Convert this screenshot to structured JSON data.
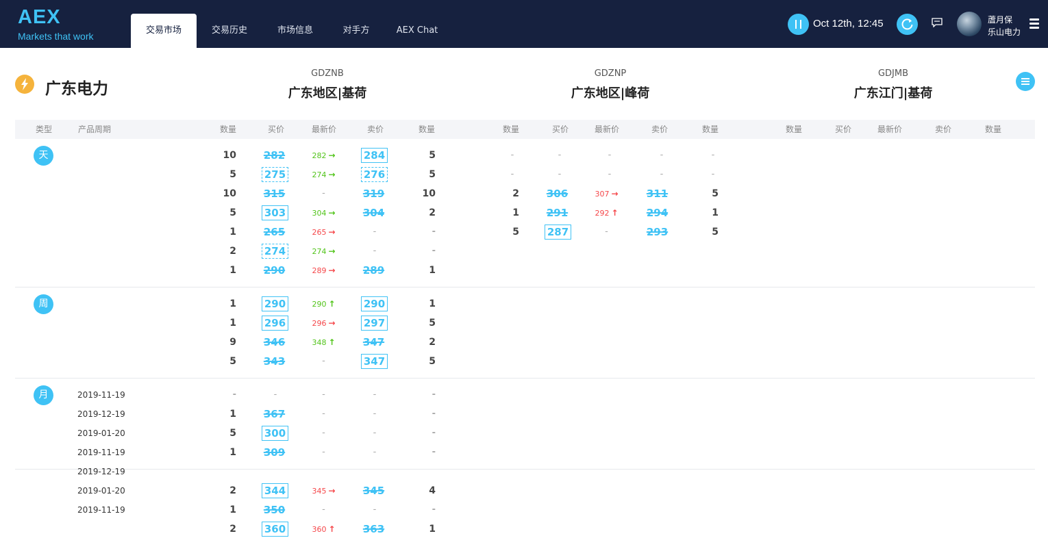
{
  "app": {
    "logo_title": "AEX",
    "logo_tagline": "Markets that work"
  },
  "nav": {
    "tabs": [
      {
        "label": "交易市场",
        "active": true
      },
      {
        "label": "交易历史"
      },
      {
        "label": "市场信息"
      },
      {
        "label": "对手方"
      },
      {
        "label": "AEX Chat"
      }
    ]
  },
  "header_right": {
    "pause_icon": "pause-icon",
    "clock": "Oct 12th, 12:45",
    "refresh_icon": "refresh-icon",
    "chat_icon": "chat-icon",
    "user_name": "蔖月保",
    "user_company": "乐山电力",
    "menu_icon": "hamburger-icon"
  },
  "market": {
    "title": "广东电力",
    "icon": "lightning-icon"
  },
  "instruments": [
    {
      "code": "GDZNB",
      "name": "广东地区|基荷"
    },
    {
      "code": "GDZNP",
      "name": "广东地区|峰荷"
    },
    {
      "code": "GDJMB",
      "name": "广东江门|基荷"
    }
  ],
  "columns": {
    "type": "类型",
    "period": "产品周期",
    "qty": "数量",
    "bid": "买价",
    "last": "最新价",
    "ask": "卖价"
  },
  "dash": "-",
  "sections": [
    {
      "type": "天",
      "rows": [
        {
          "date": "",
          "g1": {
            "bq": "10",
            "bid": "282",
            "bid_style": "strike",
            "last": "282",
            "last_dir": "right",
            "last_color": "g",
            "ask": "284",
            "ask_style": "box",
            "aq": "5"
          },
          "g2": null
        },
        {
          "date": "",
          "g1": {
            "bq": "5",
            "bid": "275",
            "bid_style": "dash",
            "last": "274",
            "last_dir": "right",
            "last_color": "g",
            "ask": "276",
            "ask_style": "dash",
            "aq": "5"
          },
          "g2": null
        },
        {
          "date": "",
          "g1": {
            "bq": "10",
            "bid": "315",
            "bid_style": "strike",
            "last": "-",
            "ask": "319",
            "ask_style": "strike",
            "aq": "10"
          },
          "g2": {
            "bq": "2",
            "bid": "306",
            "bid_style": "strike",
            "last": "307",
            "last_dir": "right",
            "last_color": "r",
            "ask": "311",
            "ask_style": "strike",
            "aq": "5"
          }
        },
        {
          "date": "",
          "g1": {
            "bq": "5",
            "bid": "303",
            "bid_style": "box",
            "last": "304",
            "last_dir": "right",
            "last_color": "g",
            "ask": "304",
            "ask_style": "strike",
            "aq": "2"
          },
          "g2": {
            "bq": "1",
            "bid": "291",
            "bid_style": "strike",
            "last": "292",
            "last_dir": "up",
            "last_color": "r",
            "ask": "294",
            "ask_style": "strike",
            "aq": "1"
          }
        },
        {
          "date": "",
          "g1": {
            "bq": "1",
            "bid": "265",
            "bid_style": "strike",
            "last": "265",
            "last_dir": "right",
            "last_color": "r",
            "ask": "-",
            "aq": "-"
          },
          "g2": {
            "bq": "5",
            "bid": "287",
            "bid_style": "box",
            "last": "-",
            "ask": "293",
            "ask_style": "strike",
            "aq": "5"
          }
        },
        {
          "date": "",
          "g1": {
            "bq": "2",
            "bid": "274",
            "bid_style": "dash",
            "last": "274",
            "last_dir": "right",
            "last_color": "g",
            "ask": "-",
            "aq": "-"
          },
          "g2": null
        },
        {
          "date": "",
          "g1": {
            "bq": "1",
            "bid": "290",
            "bid_style": "strike",
            "last": "289",
            "last_dir": "right",
            "last_color": "r",
            "ask": "289",
            "ask_style": "strike",
            "aq": "1"
          },
          "g2": null
        }
      ]
    },
    {
      "type": "周",
      "rows": [
        {
          "date": "",
          "g1": {
            "bq": "1",
            "bid": "290",
            "bid_style": "box",
            "last": "290",
            "last_dir": "up",
            "last_color": "g",
            "ask": "290",
            "ask_style": "box",
            "aq": "1"
          },
          "g2": null
        },
        {
          "date": "",
          "g1": {
            "bq": "1",
            "bid": "296",
            "bid_style": "box",
            "last": "296",
            "last_dir": "right",
            "last_color": "r",
            "ask": "297",
            "ask_style": "box",
            "aq": "5"
          },
          "g2": null
        },
        {
          "date": "",
          "g1": {
            "bq": "9",
            "bid": "346",
            "bid_style": "strike",
            "last": "348",
            "last_dir": "up",
            "last_color": "g",
            "ask": "347",
            "ask_style": "strike",
            "aq": "2"
          },
          "g2": null
        },
        {
          "date": "",
          "g1": {
            "bq": "5",
            "bid": "343",
            "bid_style": "strike",
            "last": "-",
            "ask": "347",
            "ask_style": "box",
            "aq": "5"
          },
          "g2": null
        }
      ]
    },
    {
      "type": "月",
      "rows": [
        {
          "date": "2019-11-19",
          "g1": {
            "bq": "-",
            "bid": "-",
            "last": "-",
            "ask": "-",
            "aq": "-"
          },
          "g2": null
        },
        {
          "date": "2019-12-19",
          "g1": {
            "bq": "1",
            "bid": "367",
            "bid_style": "strike",
            "last": "-",
            "ask": "-",
            "aq": "-"
          },
          "g2": null
        },
        {
          "date": "2019-01-20",
          "g1": {
            "bq": "5",
            "bid": "300",
            "bid_style": "box",
            "last": "-",
            "ask": "-",
            "aq": "-"
          },
          "g2": null
        },
        {
          "date": "2019-11-19",
          "g1": {
            "bq": "1",
            "bid": "309",
            "bid_style": "strike",
            "last": "-",
            "ask": "-",
            "aq": "-"
          },
          "g2": null
        }
      ]
    },
    {
      "type": "",
      "rows": [
        {
          "date": "2019-12-19",
          "g1": null,
          "g2": null
        },
        {
          "date": "2019-01-20",
          "g1": {
            "bq": "2",
            "bid": "344",
            "bid_style": "box",
            "last": "345",
            "last_dir": "right",
            "last_color": "r",
            "ask": "345",
            "ask_style": "strike",
            "aq": "4"
          },
          "g2": null
        },
        {
          "date": "2019-11-19",
          "g1": {
            "bq": "1",
            "bid": "350",
            "bid_style": "strike",
            "last": "-",
            "ask": "-",
            "aq": "-"
          },
          "g2": null
        },
        {
          "date": "",
          "g1": {
            "bq": "2",
            "bid": "360",
            "bid_style": "box",
            "last": "360",
            "last_dir": "up",
            "last_color": "r",
            "ask": "363",
            "ask_style": "strike",
            "aq": "1"
          },
          "g2": null
        }
      ]
    }
  ],
  "colors": {
    "topbar": "#16213f",
    "accent": "#3fc2f5",
    "up_green": "#52c41a",
    "down_red": "#f5474a",
    "lightning": "#f5b33c"
  }
}
